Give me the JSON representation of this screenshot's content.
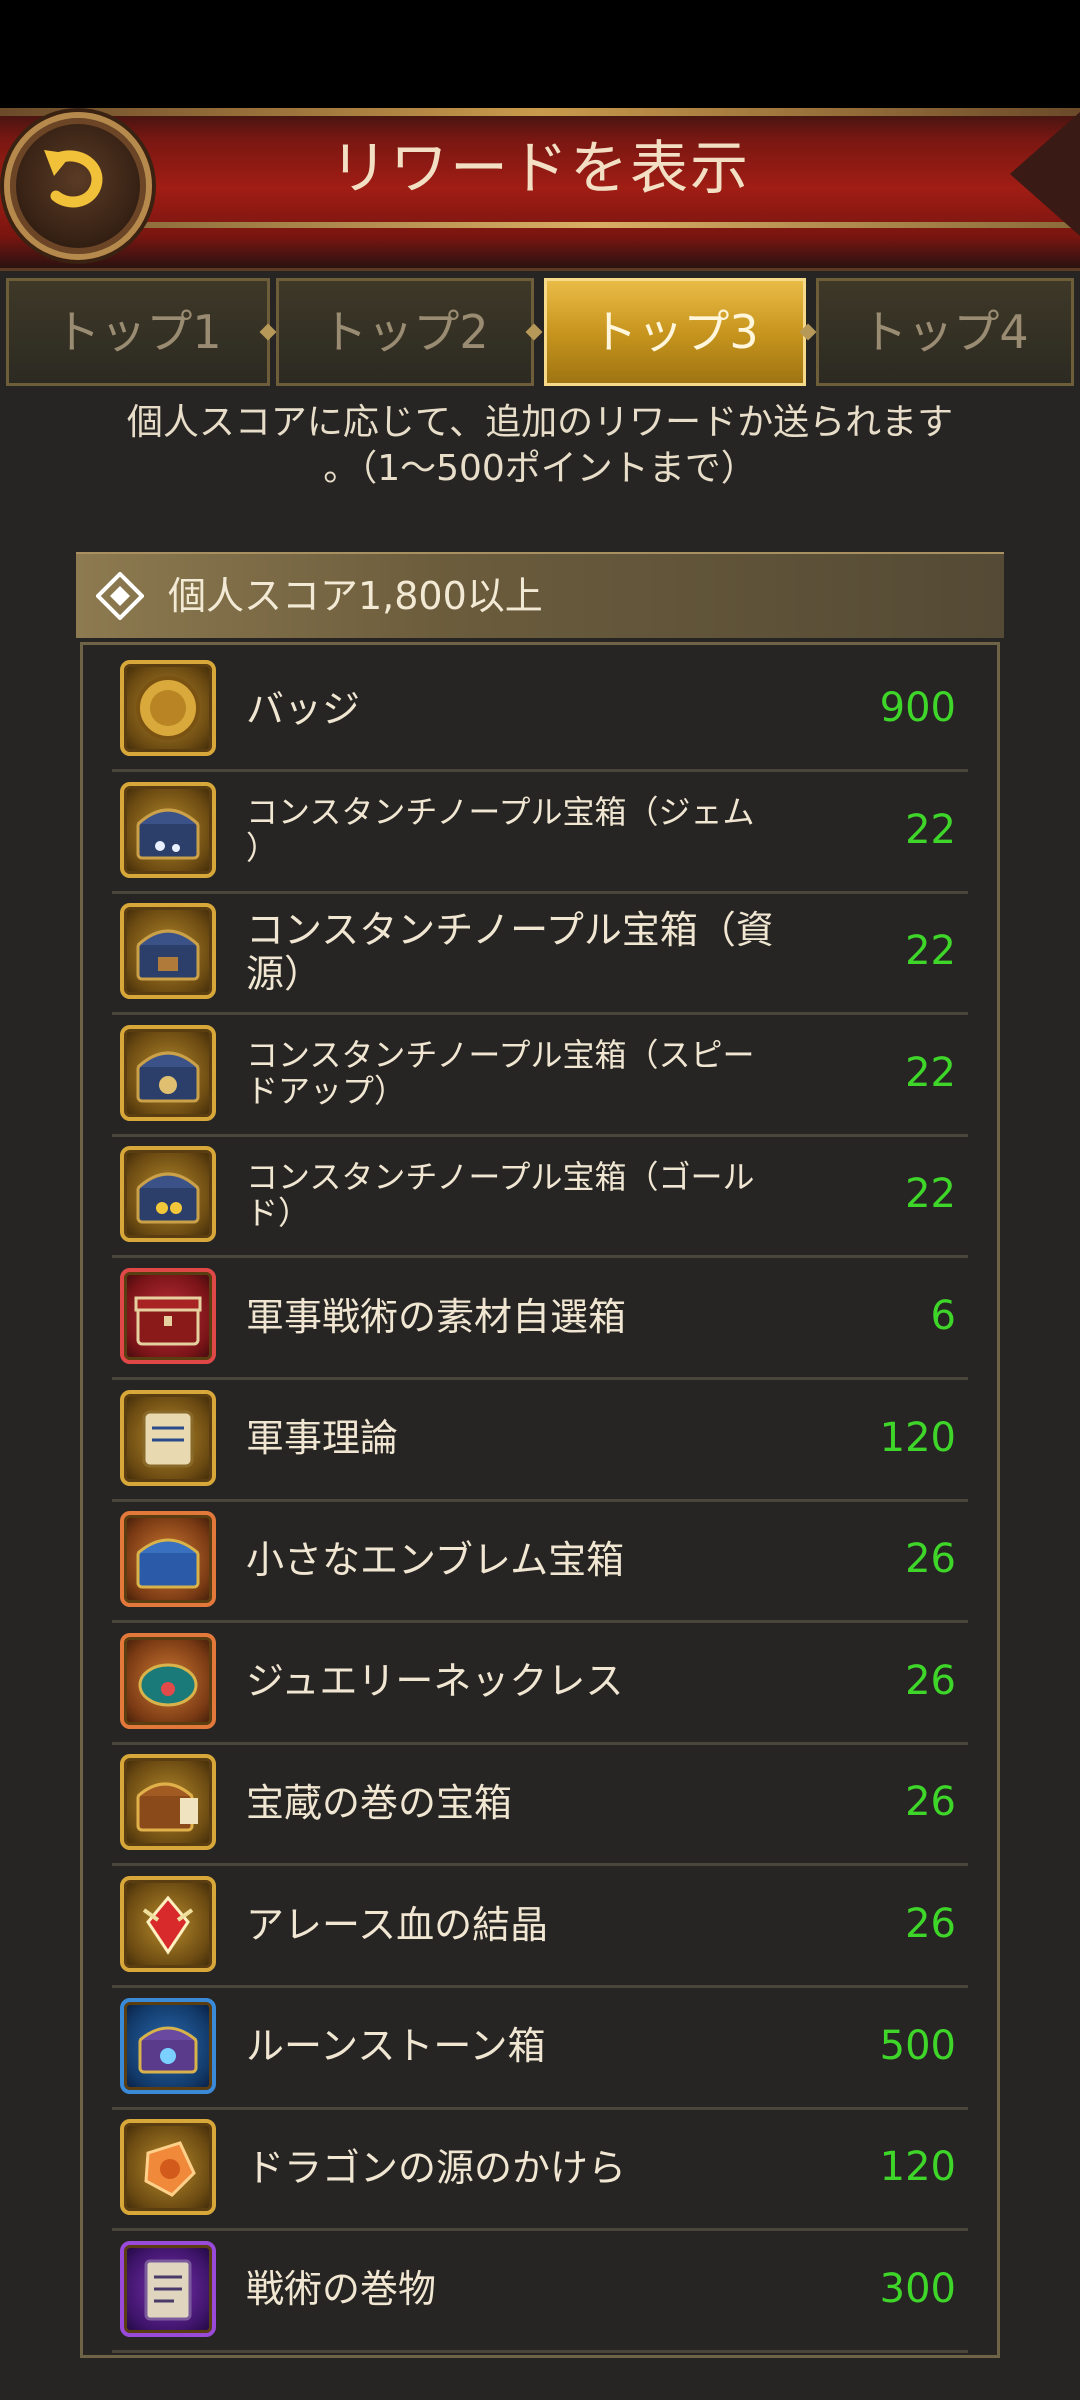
{
  "header": {
    "title": "リワードを表示"
  },
  "tabs": [
    {
      "label": "トップ1",
      "active": false
    },
    {
      "label": "トップ2",
      "active": false
    },
    {
      "label": "トップ3",
      "active": true
    },
    {
      "label": "トップ4",
      "active": false
    }
  ],
  "info": {
    "line1": "個人スコアに応じて、追加のリワードか送られます",
    "line2": "。（1〜500ポイントまで）"
  },
  "section": {
    "title": "個人スコア1,800以上"
  },
  "colors": {
    "count": "#3fd62a",
    "gold": "#d8a73a",
    "header_red": "#a01d14",
    "active_tab": "#e0ae35"
  },
  "rewards": [
    {
      "name": "バッジ",
      "count": "900",
      "icon": "badge-icon",
      "frame": "gold"
    },
    {
      "name": "コンスタンチノープル宝箱（ジェム）",
      "name_l1": "コンスタンチノープル宝箱（ジェム",
      "name_l2": "）",
      "count": "22",
      "icon": "gem-chest-icon",
      "frame": "gold"
    },
    {
      "name": "コンスタンチノープル宝箱（資源）",
      "count": "22",
      "icon": "resource-chest-icon",
      "frame": "gold"
    },
    {
      "name": "コンスタンチノープル宝箱（スピードアップ）",
      "name_l1": "コンスタンチノープル宝箱（スピー",
      "name_l2": "ドアップ）",
      "count": "22",
      "icon": "speedup-chest-icon",
      "frame": "gold"
    },
    {
      "name": "コンスタンチノープル宝箱（ゴールド）",
      "name_l1": "コンスタンチノープル宝箱（ゴール",
      "name_l2": "ド）",
      "count": "22",
      "icon": "gold-chest-icon",
      "frame": "gold"
    },
    {
      "name": "軍事戦術の素材自選箱",
      "count": "6",
      "icon": "tactics-material-box-icon",
      "frame": "red"
    },
    {
      "name": "軍事理論",
      "count": "120",
      "icon": "scroll-icon",
      "frame": "gold"
    },
    {
      "name": "小さなエンブレム宝箱",
      "count": "26",
      "icon": "emblem-chest-icon",
      "frame": "orange"
    },
    {
      "name": "ジュエリーネックレス",
      "count": "26",
      "icon": "necklace-icon",
      "frame": "orange"
    },
    {
      "name": "宝蔵の巻の宝箱",
      "count": "26",
      "icon": "treasure-scroll-chest-icon",
      "frame": "gold"
    },
    {
      "name": "アレース血の結晶",
      "count": "26",
      "icon": "blood-crystal-icon",
      "frame": "gold"
    },
    {
      "name": "ルーンストーン箱",
      "count": "500",
      "icon": "runestone-box-icon",
      "frame": "blue"
    },
    {
      "name": "ドラゴンの源のかけら",
      "count": "120",
      "icon": "dragon-fragment-icon",
      "frame": "gold"
    },
    {
      "name": "戦術の巻物",
      "count": "300",
      "icon": "tactics-scroll-icon",
      "frame": "purple"
    }
  ]
}
